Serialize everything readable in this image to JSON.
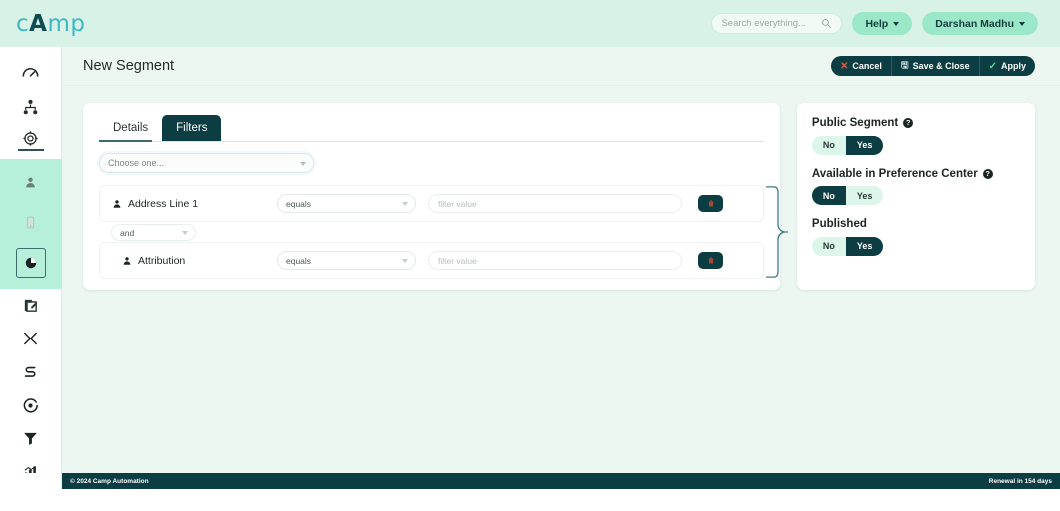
{
  "brand": {
    "logo_text_a": "c",
    "logo_text_b": "A",
    "logo_text_c": "mp"
  },
  "topbar": {
    "search_placeholder": "Search everything...",
    "help_label": "Help",
    "user_label": "Darshan Madhu"
  },
  "page": {
    "title": "New Segment",
    "actions": {
      "cancel": "Cancel",
      "save_close": "Save & Close",
      "apply": "Apply"
    }
  },
  "sidebar": {
    "items": [
      {
        "icon": "gauge-icon",
        "name": "sidebar-item-dashboard"
      },
      {
        "icon": "hierarchy-icon",
        "name": "sidebar-item-journeys"
      },
      {
        "icon": "target-globe-icon",
        "name": "sidebar-item-campaigns"
      },
      {
        "icon": "person-icon",
        "name": "sidebar-item-contacts"
      },
      {
        "icon": "document-icon",
        "name": "sidebar-item-forms"
      },
      {
        "icon": "pie-chart-icon",
        "name": "sidebar-item-segments"
      },
      {
        "icon": "edit-square-icon",
        "name": "sidebar-item-editor"
      },
      {
        "icon": "shuffle-icon",
        "name": "sidebar-item-shuffle"
      },
      {
        "icon": "path-icon",
        "name": "sidebar-item-flow"
      },
      {
        "icon": "goal-icon",
        "name": "sidebar-item-goals"
      },
      {
        "icon": "funnel-icon",
        "name": "sidebar-item-filters"
      },
      {
        "icon": "bar-chart-icon",
        "name": "sidebar-item-reports"
      }
    ]
  },
  "tabs": [
    {
      "label": "Details",
      "active": false
    },
    {
      "label": "Filters",
      "active": true
    }
  ],
  "filters": {
    "choose_placeholder": "Choose one...",
    "conjunction": "and",
    "rows": [
      {
        "field": "Address Line 1",
        "operator": "equals",
        "value_placeholder": "filter value"
      },
      {
        "field": "Attribution",
        "operator": "equals",
        "value_placeholder": "filter value"
      }
    ]
  },
  "side_panel": {
    "groups": [
      {
        "label": "Public Segment",
        "has_help": true,
        "no": "No",
        "yes": "Yes",
        "selected": "Yes"
      },
      {
        "label": "Available in Preference Center",
        "has_help": true,
        "no": "No",
        "yes": "Yes",
        "selected": "No"
      },
      {
        "label": "Published",
        "has_help": false,
        "no": "No",
        "yes": "Yes",
        "selected": "Yes"
      }
    ]
  },
  "footer": {
    "copyright": "© 2024 Camp Automation",
    "renewal": "Renewal in 154 days"
  },
  "colors": {
    "brand_teal": "#0c3d42",
    "mint": "#b6f0da",
    "topbar_bg": "#d9f2e7",
    "content_bg": "#edf7f2",
    "accent_green": "#9ae8c8"
  }
}
